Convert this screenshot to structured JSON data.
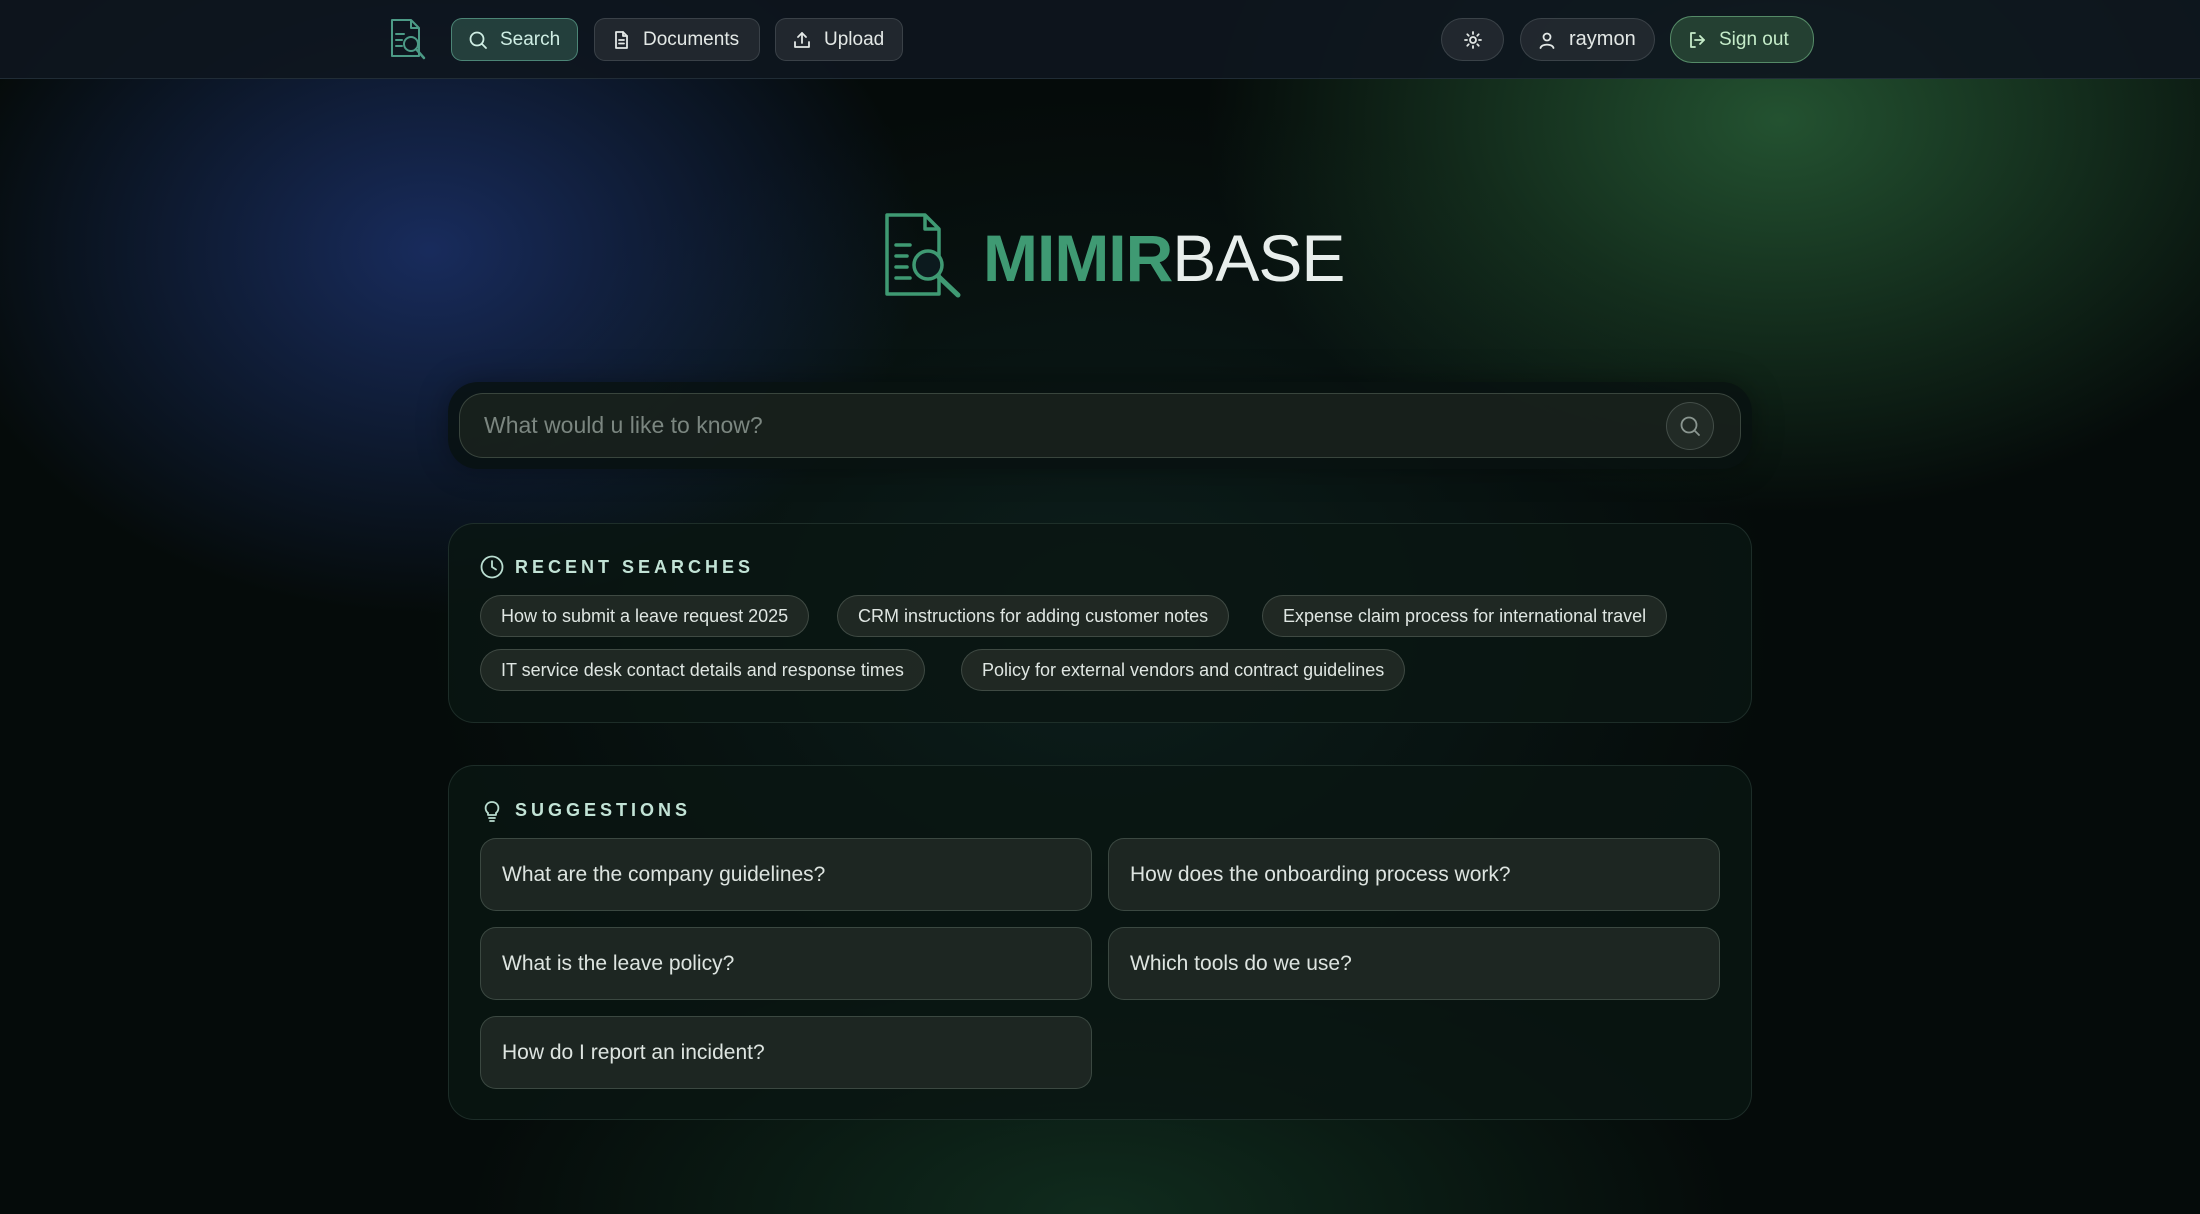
{
  "nav": {
    "items": [
      {
        "label": "Search",
        "icon": "search-icon",
        "active": true
      },
      {
        "label": "Documents",
        "icon": "document-icon",
        "active": false
      },
      {
        "label": "Upload",
        "icon": "upload-icon",
        "active": false
      }
    ],
    "theme_icon": "sun-icon",
    "user": {
      "name": "raymon",
      "icon": "user-icon"
    },
    "signout_label": "Sign out"
  },
  "brand": {
    "strong": "MIMIR",
    "light": "BASE"
  },
  "search": {
    "placeholder": "What would u like to know?",
    "value": ""
  },
  "recent": {
    "title": "RECENT SEARCHES",
    "icon": "clock-icon",
    "items": [
      "How to submit a leave request 2025",
      "CRM instructions for adding customer notes",
      "Expense claim process for international travel",
      "IT service desk contact details and response times",
      "Policy for external vendors and contract guidelines"
    ]
  },
  "suggestions": {
    "title": "SUGGESTIONS",
    "icon": "lightbulb-icon",
    "items": [
      "What are the company guidelines?",
      "How does the onboarding process work?",
      "What is the leave policy?",
      "Which tools do we use?",
      "How do I report an incident?"
    ]
  },
  "colors": {
    "accent": "#3f9a73",
    "background": "#050b0a",
    "active_nav": "#284642"
  }
}
